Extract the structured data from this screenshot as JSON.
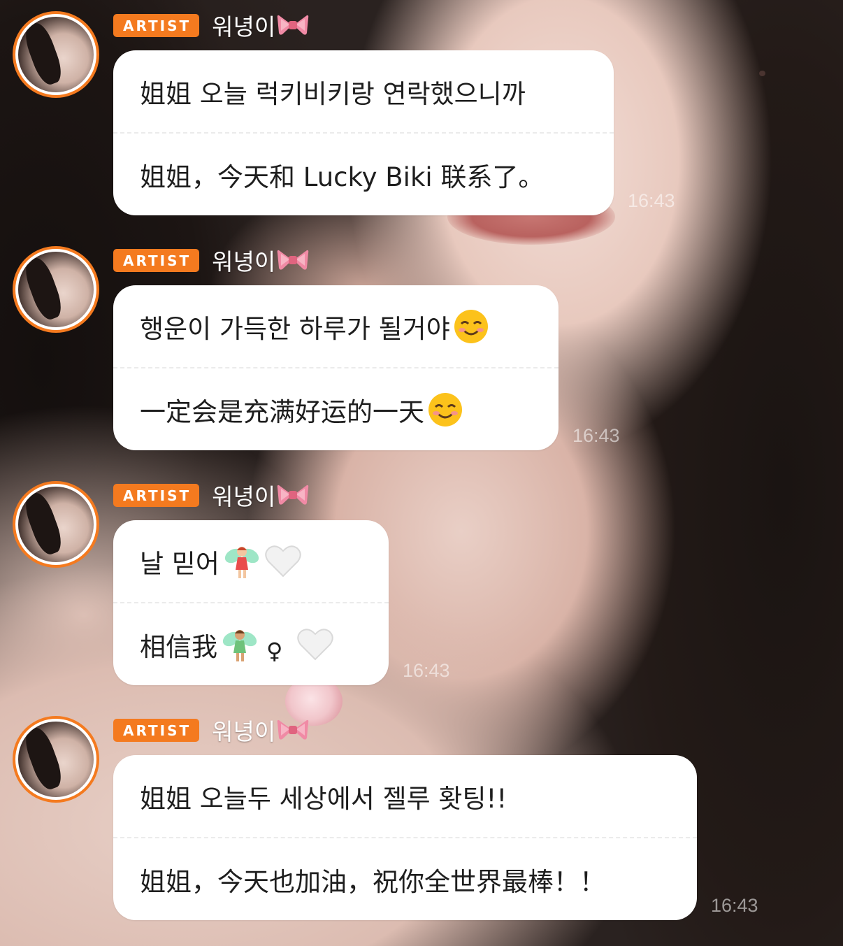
{
  "badge_label": "ARTIST",
  "colors": {
    "accent": "#f47a1f",
    "bubble": "#ffffff",
    "text": "#1e1e1e"
  },
  "icons": [
    "ribbon-bow-icon",
    "smiling-face-icon",
    "fairy-icon",
    "white-heart-icon",
    "female-sign-icon"
  ],
  "messages": [
    {
      "sender": "워녕이",
      "korean": "姐姐 오늘 럭키비키랑 연락했으니까",
      "chinese": "姐姐，今天和 Lucky Biki 联系了。",
      "time": "16:43"
    },
    {
      "sender": "워녕이",
      "korean": "행운이 가득한 하루가 될거야",
      "chinese": "一定会是充满好运的一天",
      "time": "16:43"
    },
    {
      "sender": "워녕이",
      "korean": "날 믿어",
      "chinese": "相信我",
      "chinese_extra": "♀",
      "time": "16:43"
    },
    {
      "sender": "워녕이",
      "korean": "姐姐 오늘두 세상에서 젤루 홧팅!!",
      "chinese": "姐姐，今天也加油，祝你全世界最棒！！",
      "time": "16:43"
    }
  ]
}
